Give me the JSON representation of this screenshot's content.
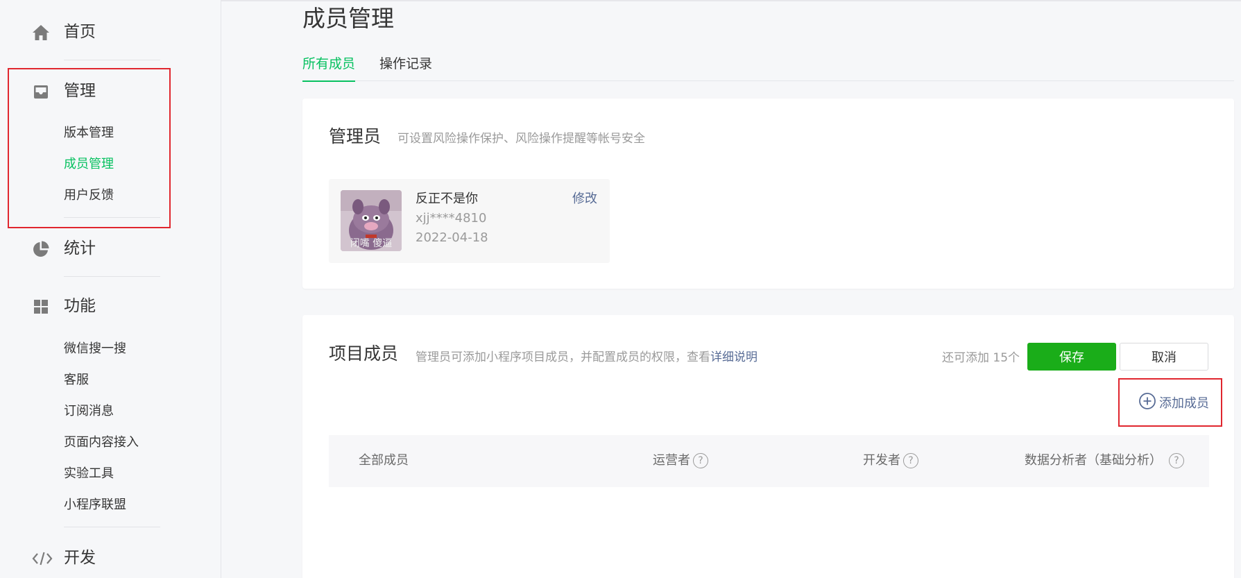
{
  "sidebar": {
    "home": "首页",
    "manage": {
      "label": "管理",
      "items": [
        "版本管理",
        "成员管理",
        "用户反馈"
      ],
      "active_index": 1
    },
    "stats": "统计",
    "features": {
      "label": "功能",
      "items": [
        "微信搜一搜",
        "客服",
        "订阅消息",
        "页面内容接入",
        "实验工具",
        "小程序联盟"
      ]
    },
    "dev": "开发"
  },
  "page": {
    "title": "成员管理",
    "tabs": [
      "所有成员",
      "操作记录"
    ],
    "active_tab": 0
  },
  "admin_card": {
    "title": "管理员",
    "desc": "可设置风险操作保护、风险操作提醒等帐号安全",
    "admin": {
      "name": "反正不是你",
      "account": "xjj****4810",
      "date": "2022-04-18",
      "edit_label": "修改",
      "avatar_caption": "闭嘴 傻逼"
    }
  },
  "members_card": {
    "title": "项目成员",
    "desc": "管理员可添加小程序项目成员，并配置成员的权限，查看",
    "desc_link": "详细说明",
    "remaining": "还可添加 15个",
    "save_label": "保存",
    "cancel_label": "取消",
    "add_member_label": "添加成员",
    "columns": [
      "全部成员",
      "运营者",
      "开发者",
      "数据分析者（基础分析）"
    ],
    "help_glyph": "?"
  },
  "colors": {
    "accent_green": "#07c160",
    "save_green": "#1aad19",
    "link_blue": "#576b95",
    "highlight_red": "#e0262e"
  }
}
